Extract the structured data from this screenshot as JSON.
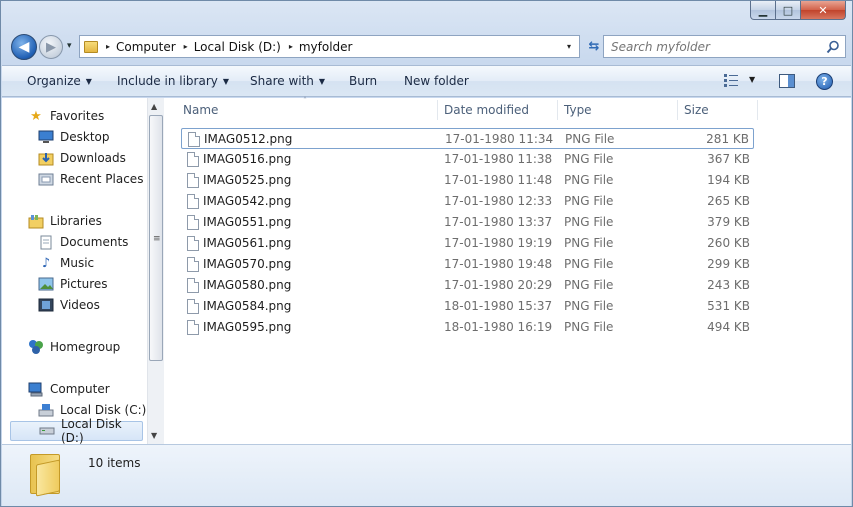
{
  "caption": {
    "minimize": "▁",
    "maximize": "□",
    "close": "✕"
  },
  "nav": {
    "back": "◀",
    "forward": "▶",
    "dropdown": "▾"
  },
  "address": {
    "crumbs": [
      "Computer",
      "Local Disk (D:)",
      "myfolder"
    ],
    "separator": "▸",
    "dropdown": "▾"
  },
  "refresh_glyph": "⇆",
  "search": {
    "placeholder": "Search myfolder"
  },
  "toolbar": {
    "organize": "Organize",
    "include_in_library": "Include in library",
    "share_with": "Share with",
    "burn": "Burn",
    "new_folder": "New folder",
    "arrow": "▼",
    "help": "?"
  },
  "sidebar": {
    "favorites": "Favorites",
    "desktop": "Desktop",
    "downloads": "Downloads",
    "recent_places": "Recent Places",
    "libraries": "Libraries",
    "documents": "Documents",
    "music": "Music",
    "pictures": "Pictures",
    "videos": "Videos",
    "homegroup": "Homegroup",
    "computer": "Computer",
    "local_disk_c": "Local Disk (C:)",
    "local_disk_d": "Local Disk (D:)"
  },
  "scrollbar": {
    "up": "▲",
    "down": "▼",
    "grip": "≡"
  },
  "columns": {
    "name": "Name",
    "date_modified": "Date modified",
    "type": "Type",
    "size": "Size",
    "sort_indicator": "˄"
  },
  "files": [
    {
      "name": "IMAG0512.png",
      "date": "17-01-1980 11:34",
      "type": "PNG File",
      "size": "281 KB"
    },
    {
      "name": "IMAG0516.png",
      "date": "17-01-1980 11:38",
      "type": "PNG File",
      "size": "367 KB"
    },
    {
      "name": "IMAG0525.png",
      "date": "17-01-1980 11:48",
      "type": "PNG File",
      "size": "194 KB"
    },
    {
      "name": "IMAG0542.png",
      "date": "17-01-1980 12:33",
      "type": "PNG File",
      "size": "265 KB"
    },
    {
      "name": "IMAG0551.png",
      "date": "17-01-1980 13:37",
      "type": "PNG File",
      "size": "379 KB"
    },
    {
      "name": "IMAG0561.png",
      "date": "17-01-1980 19:19",
      "type": "PNG File",
      "size": "260 KB"
    },
    {
      "name": "IMAG0570.png",
      "date": "17-01-1980 19:48",
      "type": "PNG File",
      "size": "299 KB"
    },
    {
      "name": "IMAG0580.png",
      "date": "17-01-1980 20:29",
      "type": "PNG File",
      "size": "243 KB"
    },
    {
      "name": "IMAG0584.png",
      "date": "18-01-1980 15:37",
      "type": "PNG File",
      "size": "531 KB"
    },
    {
      "name": "IMAG0595.png",
      "date": "18-01-1980 16:19",
      "type": "PNG File",
      "size": "494 KB"
    }
  ],
  "details": {
    "item_count": "10 items"
  },
  "colors": {
    "accent": "#1f5fb4",
    "selection_border": "#7da2ce",
    "window_frame": "#c9d9ee"
  }
}
